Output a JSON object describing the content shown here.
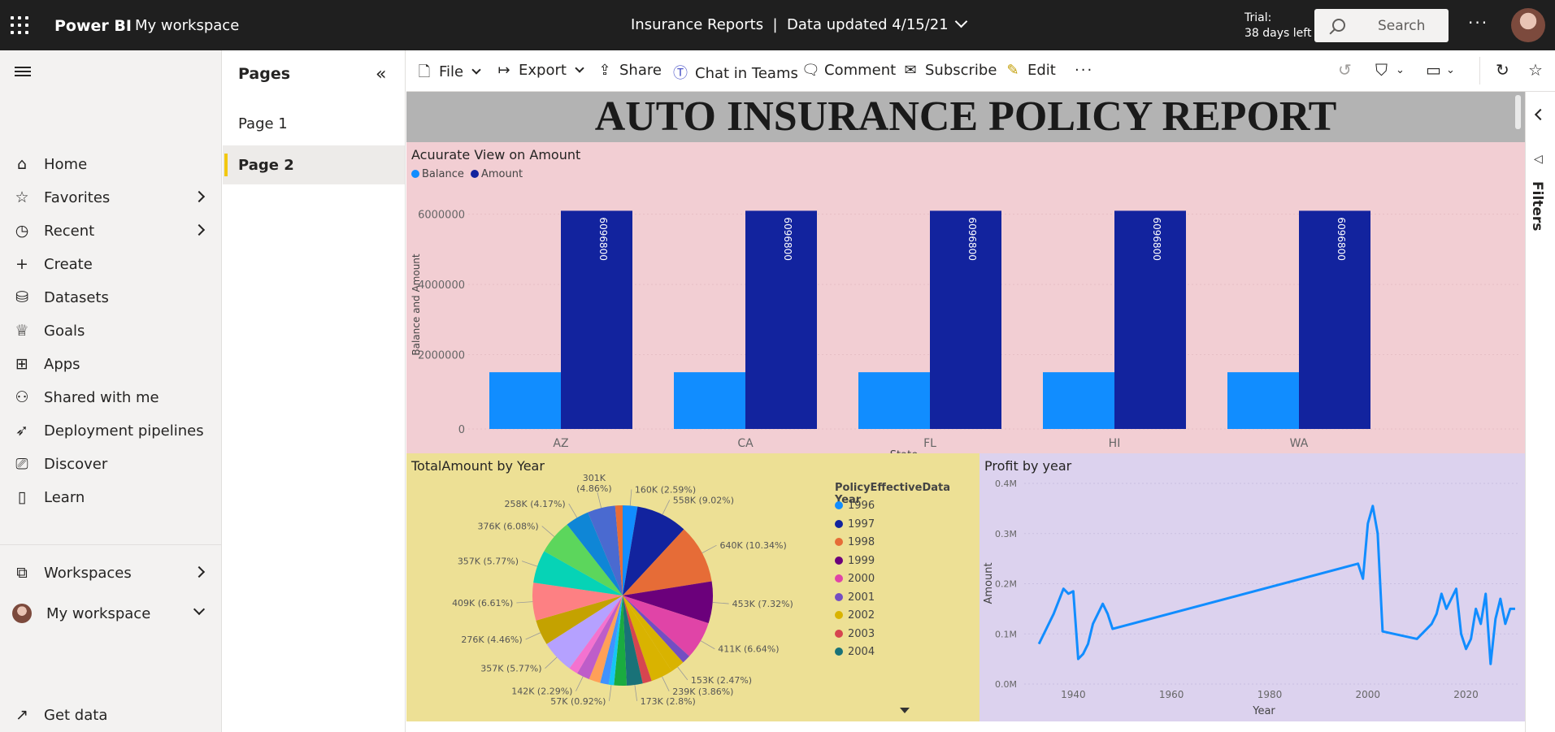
{
  "topbar": {
    "brand": "Power BI",
    "workspace": "My workspace",
    "report_title": "Insurance Reports  |  Data updated 4/15/21",
    "trial_line1": "Trial:",
    "trial_line2": "38 days left",
    "search_placeholder": "Search",
    "more": "···"
  },
  "nav": {
    "items": [
      {
        "label": "Home",
        "icon": "⌂"
      },
      {
        "label": "Favorites",
        "icon": "☆"
      },
      {
        "label": "Recent",
        "icon": "◷"
      },
      {
        "label": "Create",
        "icon": "+"
      },
      {
        "label": "Datasets",
        "icon": "⛁"
      },
      {
        "label": "Goals",
        "icon": "♕"
      },
      {
        "label": "Apps",
        "icon": "⊞"
      },
      {
        "label": "Shared with me",
        "icon": "⚇"
      },
      {
        "label": "Deployment pipelines",
        "icon": "➶"
      },
      {
        "label": "Discover",
        "icon": "⎚"
      },
      {
        "label": "Learn",
        "icon": "▯"
      }
    ],
    "workspaces": "Workspaces",
    "my_workspace": "My workspace",
    "get_data": "Get data",
    "get_data_icon": "↗"
  },
  "pages": {
    "title": "Pages",
    "collapse": "«",
    "items": [
      "Page 1",
      "Page 2"
    ],
    "selected": "Page 2"
  },
  "commands": {
    "file": "File",
    "export": "Export",
    "share": "Share",
    "chat": "Chat in Teams",
    "comment": "Comment",
    "subscribe": "Subscribe",
    "edit": "Edit",
    "more": "···"
  },
  "report": {
    "title": "AUTO INSURANCE POLICY REPORT"
  },
  "filters": {
    "label": "Filters"
  },
  "colors": {
    "balance": "#118dff",
    "amount": "#12239e",
    "line": "#118dff"
  },
  "chart_data": [
    {
      "type": "bar",
      "title": "Acuurate View on Amount",
      "xlabel": "State",
      "ylabel": "Balance and Amount",
      "categories": [
        "AZ",
        "CA",
        "FL",
        "HI",
        "WA"
      ],
      "series": [
        {
          "name": "Balance",
          "values": [
            1500000,
            1500000,
            1500000,
            1500000,
            1500000
          ]
        },
        {
          "name": "Amount",
          "values": [
            6096800,
            6096800,
            6096800,
            6096800,
            6096800
          ]
        }
      ],
      "data_labels": [
        "6096800",
        "6096800",
        "6096800",
        "6096800",
        "6096800"
      ],
      "yticks": [
        "0",
        "2000000",
        "4000000",
        "6000000"
      ],
      "ylim": [
        0,
        6500000
      ],
      "legend": "top-left"
    },
    {
      "type": "pie",
      "title": "TotalAmount by Year",
      "legend_title": "PolicyEffectiveData Year",
      "legend": [
        {
          "label": "1996",
          "color": "#118dff"
        },
        {
          "label": "1997",
          "color": "#12239e"
        },
        {
          "label": "1998",
          "color": "#e66c37"
        },
        {
          "label": "1999",
          "color": "#6b007b"
        },
        {
          "label": "2000",
          "color": "#e044a7"
        },
        {
          "label": "2001",
          "color": "#744ec2"
        },
        {
          "label": "2002",
          "color": "#d9b300"
        },
        {
          "label": "2003",
          "color": "#d64550"
        },
        {
          "label": "2004",
          "color": "#197278"
        }
      ],
      "slices": [
        {
          "label": "160K (2.59%)",
          "value": 2.59,
          "color": "#118dff"
        },
        {
          "label": "558K (9.02%)",
          "value": 9.02,
          "color": "#12239e"
        },
        {
          "label": "640K (10.34%)",
          "value": 10.34,
          "color": "#e66c37"
        },
        {
          "label": "453K (7.32%)",
          "value": 7.32,
          "color": "#6b007b"
        },
        {
          "label": "411K (6.64%)",
          "value": 6.64,
          "color": "#e044a7"
        },
        {
          "label": "",
          "value": 1.5,
          "color": "#744ec2"
        },
        {
          "label": "153K (2.47%)",
          "value": 2.47,
          "color": "#d9b300"
        },
        {
          "label": "239K (3.86%)",
          "value": 3.86,
          "color": "#d9b300"
        },
        {
          "label": "",
          "value": 1.6,
          "color": "#d64550"
        },
        {
          "label": "173K (2.8%)",
          "value": 2.8,
          "color": "#197278"
        },
        {
          "label": "",
          "value": 2.2,
          "color": "#1aab40"
        },
        {
          "label": "57K (0.92%)",
          "value": 0.92,
          "color": "#15c6f4"
        },
        {
          "label": "",
          "value": 1.5,
          "color": "#4092ff"
        },
        {
          "label": "",
          "value": 2.0,
          "color": "#ffa058"
        },
        {
          "label": "142K (2.29%)",
          "value": 2.29,
          "color": "#be5dc9"
        },
        {
          "label": "",
          "value": 1.6,
          "color": "#f472d0"
        },
        {
          "label": "357K (5.77%)",
          "value": 5.77,
          "color": "#b5a1ff"
        },
        {
          "label": "276K (4.46%)",
          "value": 4.46,
          "color": "#c4a200"
        },
        {
          "label": "409K (6.61%)",
          "value": 6.61,
          "color": "#fd8083"
        },
        {
          "label": "357K (5.77%)",
          "value": 5.77,
          "color": "#06d3b6"
        },
        {
          "label": "376K (6.08%)",
          "value": 6.08,
          "color": "#5cd65c"
        },
        {
          "label": "258K (4.17%)",
          "value": 4.17,
          "color": "#0f86d6"
        },
        {
          "label": "301K (4.86%)",
          "value": 4.86,
          "color": "#4a6ad0"
        },
        {
          "label": "",
          "value": 1.3,
          "color": "#e66c37"
        }
      ]
    },
    {
      "type": "line",
      "title": "Profit by year",
      "xlabel": "Year",
      "ylabel": "Amount",
      "xticks": [
        "1940",
        "1960",
        "1980",
        "2000",
        "2020"
      ],
      "yticks": [
        "0.0M",
        "0.1M",
        "0.2M",
        "0.3M",
        "0.4M"
      ],
      "xlim": [
        1930,
        2031
      ],
      "ylim": [
        0,
        400000
      ],
      "series": [
        {
          "name": "",
          "x": [
            1933,
            1934,
            1936,
            1938,
            1939,
            1940,
            1941,
            1942,
            1943,
            1944,
            1945,
            1946,
            1947,
            1948,
            1998,
            1999,
            2000,
            2001,
            2002,
            2003,
            2010,
            2013,
            2014,
            2015,
            2016,
            2017,
            2018,
            2019,
            2020,
            2021,
            2022,
            2023,
            2024,
            2025,
            2026,
            2027,
            2028,
            2029,
            2030
          ],
          "y": [
            80000,
            100000,
            140000,
            190000,
            180000,
            185000,
            50000,
            60000,
            80000,
            120000,
            140000,
            160000,
            140000,
            110000,
            240000,
            210000,
            320000,
            355000,
            300000,
            105000,
            90000,
            120000,
            140000,
            180000,
            150000,
            170000,
            190000,
            100000,
            70000,
            90000,
            150000,
            120000,
            180000,
            40000,
            130000,
            170000,
            120000,
            150000,
            150000
          ]
        }
      ]
    }
  ]
}
